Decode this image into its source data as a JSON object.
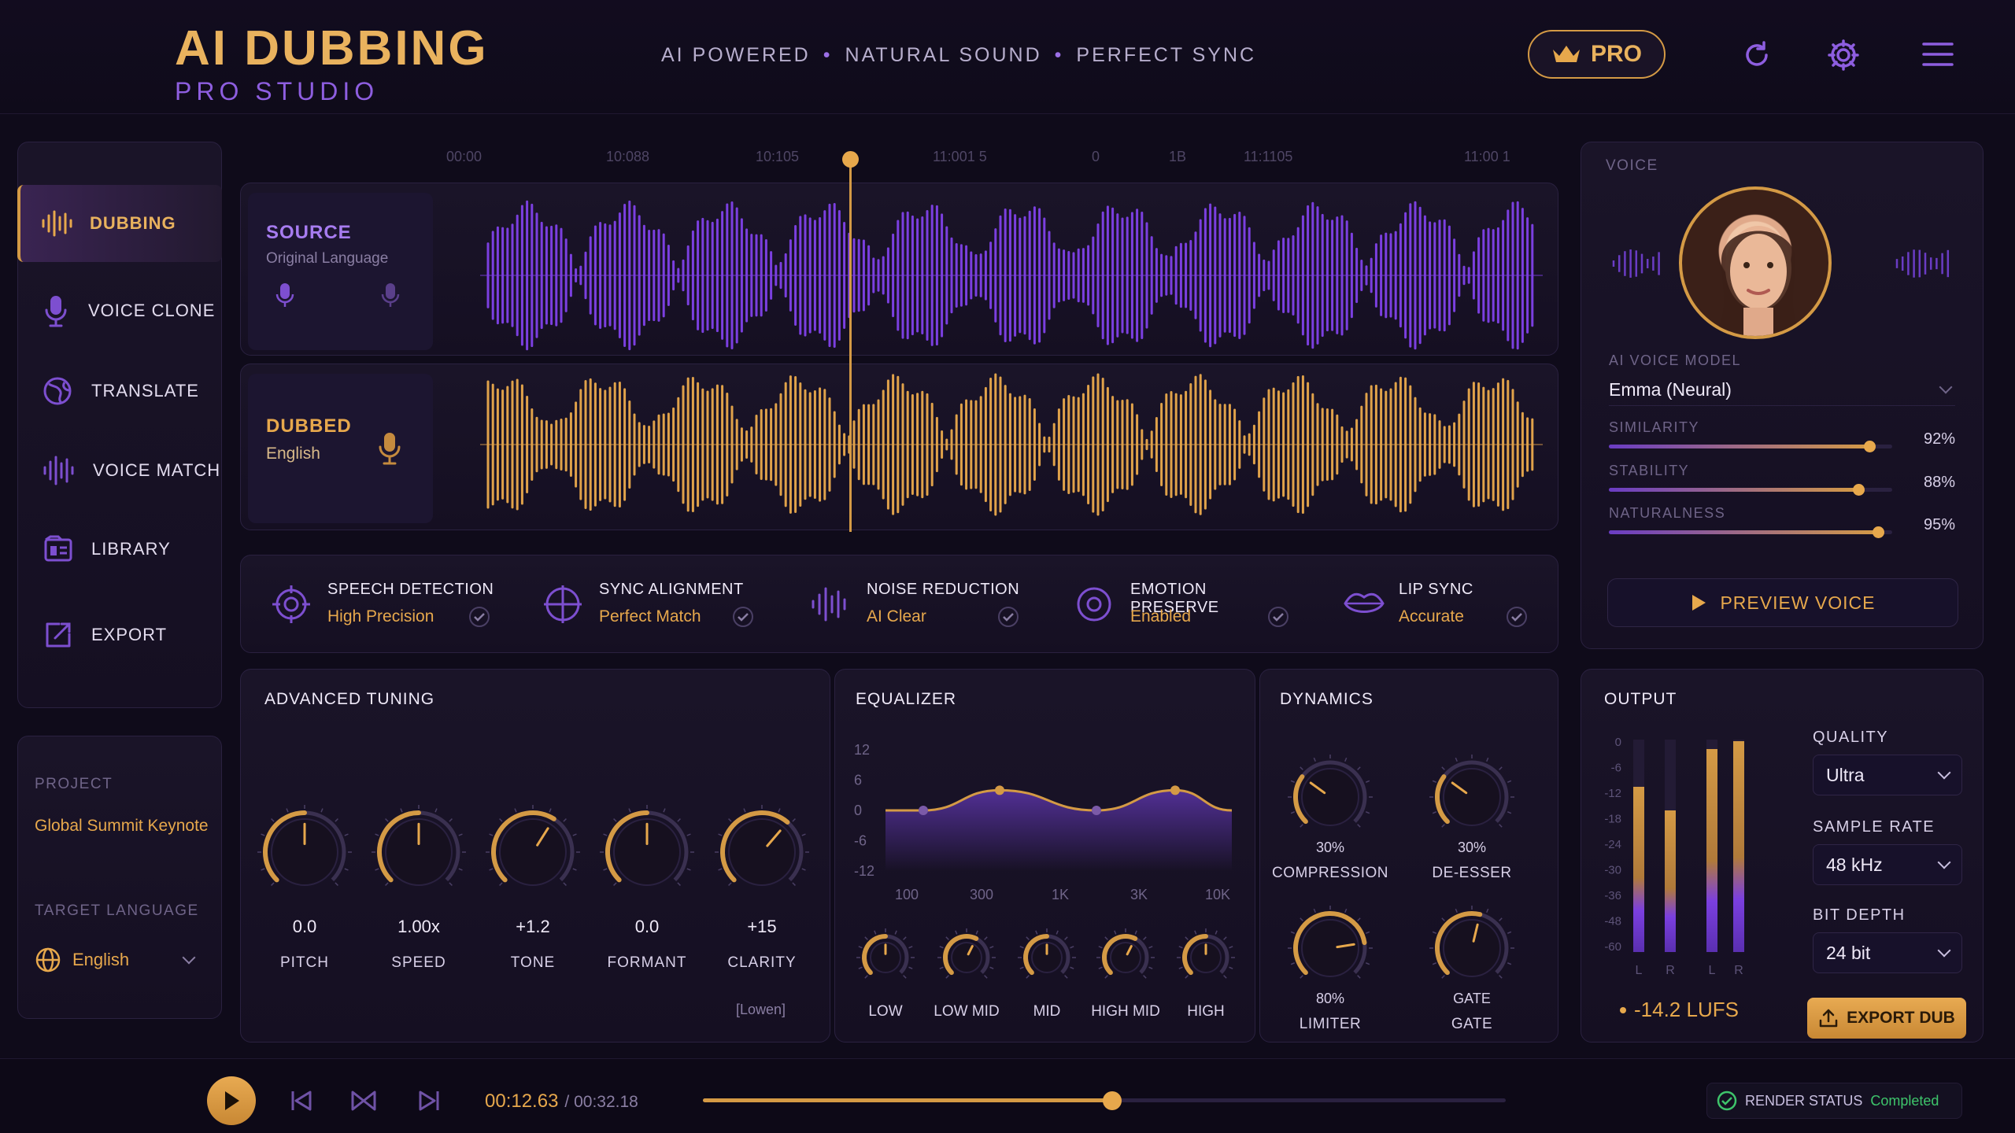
{
  "header": {
    "title": "AI DUBBING",
    "subtitle": "PRO STUDIO",
    "tagline": [
      "AI POWERED",
      "NATURAL SOUND",
      "PERFECT SYNC"
    ],
    "pro_label": "PRO"
  },
  "nav": {
    "items": [
      {
        "label": "DUBBING",
        "icon": "waveform-icon",
        "active": true
      },
      {
        "label": "VOICE CLONE",
        "icon": "microphone-icon"
      },
      {
        "label": "TRANSLATE",
        "icon": "globe-icon"
      },
      {
        "label": "VOICE MATCH",
        "icon": "waveform-match-icon"
      },
      {
        "label": "LIBRARY",
        "icon": "library-icon"
      },
      {
        "label": "EXPORT",
        "icon": "export-icon"
      }
    ]
  },
  "project": {
    "label": "PROJECT",
    "name": "Global Summit Keynote",
    "target_label": "TARGET LANGUAGE",
    "target_value": "English"
  },
  "timeline": {
    "ticks": [
      "00:00",
      "10:088",
      "10:105",
      "11:001 5",
      "0",
      "1B",
      "11:1105",
      "11:00 1"
    ],
    "playhead_fraction": 0.39
  },
  "tracks": {
    "source": {
      "title": "SOURCE",
      "subtitle": "Original Language"
    },
    "dubbed": {
      "title": "DUBBED",
      "subtitle": "English"
    }
  },
  "features": [
    {
      "title": "SPEECH DETECTION",
      "value": "High Precision",
      "icon": "target-icon"
    },
    {
      "title": "SYNC ALIGNMENT",
      "value": "Perfect Match",
      "icon": "crosshair-icon"
    },
    {
      "title": "NOISE REDUCTION",
      "value": "AI Clear",
      "icon": "waveform-icon"
    },
    {
      "title": "EMOTION PRESERVE",
      "value": "Enabled",
      "icon": "emotion-icon"
    },
    {
      "title": "LIP SYNC",
      "value": "Accurate",
      "icon": "lips-icon"
    }
  ],
  "voice": {
    "header": "VOICE",
    "model_label": "AI VOICE MODEL",
    "model_value": "Emma (Neural)",
    "sliders": [
      {
        "label": "SIMILARITY",
        "value": "92%",
        "level": 0.92
      },
      {
        "label": "STABILITY",
        "value": "88%",
        "level": 0.88
      },
      {
        "label": "NATURALNESS",
        "value": "95%",
        "level": 0.95
      }
    ],
    "preview_label": "PREVIEW VOICE"
  },
  "tuning": {
    "header": "ADVANCED TUNING",
    "knobs": [
      {
        "label": "PITCH",
        "value": "0.0",
        "level": 0.5
      },
      {
        "label": "SPEED",
        "value": "1.00x",
        "level": 0.5
      },
      {
        "label": "TONE",
        "value": "+1.2",
        "level": 0.62
      },
      {
        "label": "FORMANT",
        "value": "0.0",
        "level": 0.5
      },
      {
        "label": "CLARITY",
        "value": "+15",
        "level": 0.65
      }
    ],
    "footer": "[Lowen]"
  },
  "equalizer": {
    "header": "EQUALIZER",
    "y_ticks": [
      "12",
      "6",
      "0",
      "-6",
      "-12"
    ],
    "x_ticks": [
      "100",
      "300",
      "1K",
      "3K",
      "10K"
    ],
    "bands": [
      {
        "label": "LOW",
        "gain": 0
      },
      {
        "label": "LOW MID",
        "gain": 2
      },
      {
        "label": "MID",
        "gain": 0
      },
      {
        "label": "HIGH MID",
        "gain": 2
      },
      {
        "label": "HIGH",
        "gain": 0
      }
    ]
  },
  "dynamics": {
    "header": "DYNAMICS",
    "knobs": [
      {
        "label": "COMPRESSION",
        "value": "30%",
        "level": 0.3
      },
      {
        "label": "DE-ESSER",
        "value": "30%",
        "level": 0.3
      },
      {
        "label": "LIMITER",
        "value": "80%",
        "level": 0.8
      },
      {
        "label": "GATE",
        "value": "GATE",
        "level": 0.55
      }
    ]
  },
  "output": {
    "header": "OUTPUT",
    "meter_ticks": [
      "0",
      "-6",
      "-12",
      "-18",
      "-24",
      "-30",
      "-36",
      "-48",
      "-60"
    ],
    "meter_labels": [
      "L",
      "R",
      "L",
      "R"
    ],
    "lufs": "-14.2 LUFS",
    "quality_label": "QUALITY",
    "quality_value": "Ultra",
    "sample_rate_label": "SAMPLE RATE",
    "sample_rate_value": "48 kHz",
    "bit_depth_label": "BIT DEPTH",
    "bit_depth_value": "24 bit",
    "export_label": "EXPORT DUB"
  },
  "transport": {
    "current": "00:12.63",
    "total": "/ 00:32.18",
    "progress": 0.51,
    "render_label": "RENDER STATUS",
    "render_value": "Completed"
  },
  "colors": {
    "gold": "#e7a84c",
    "purple": "#7c3aed",
    "bg": "#0f0b1a"
  }
}
